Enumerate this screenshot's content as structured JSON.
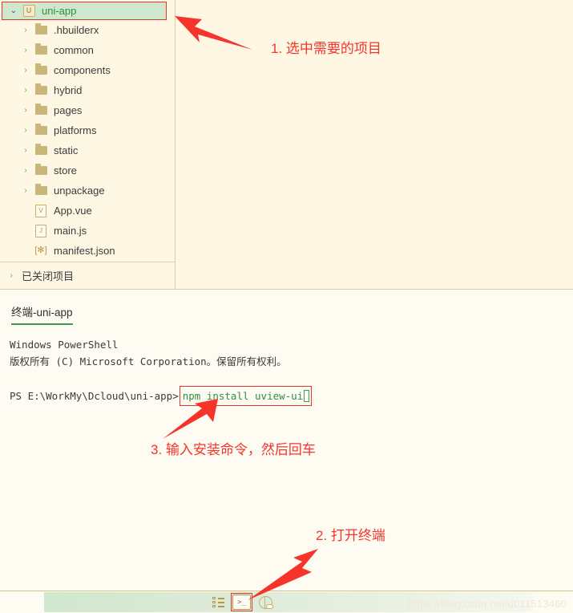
{
  "explorer": {
    "root": {
      "label": "uni-app",
      "icon": "uni-app-logo-icon",
      "chevron": "⌄",
      "badge": "U"
    },
    "items": [
      {
        "label": ".hbuilderx",
        "type": "folder",
        "chevron": "›"
      },
      {
        "label": "common",
        "type": "folder",
        "chevron": "›"
      },
      {
        "label": "components",
        "type": "folder",
        "chevron": "›"
      },
      {
        "label": "hybrid",
        "type": "folder",
        "chevron": "›"
      },
      {
        "label": "pages",
        "type": "folder",
        "chevron": "›"
      },
      {
        "label": "platforms",
        "type": "folder",
        "chevron": "›"
      },
      {
        "label": "static",
        "type": "folder",
        "chevron": "›"
      },
      {
        "label": "store",
        "type": "folder",
        "chevron": "›"
      },
      {
        "label": "unpackage",
        "type": "folder",
        "chevron": "›"
      },
      {
        "label": "App.vue",
        "type": "file",
        "glyph": "V"
      },
      {
        "label": "main.js",
        "type": "file",
        "glyph": "J"
      },
      {
        "label": "manifest.json",
        "type": "file",
        "glyph": "[✻]"
      }
    ],
    "closed_projects": {
      "label": "已关闭项目",
      "chevron": "›"
    }
  },
  "terminal": {
    "tab_label": "终端-uni-app",
    "lines": [
      "Windows PowerShell",
      "版权所有 (C) Microsoft Corporation。保留所有权利。"
    ],
    "prompt": "PS E:\\WorkMy\\Dcloud\\uni-app>",
    "command": "npm install uview-ui"
  },
  "statusbar": {
    "outline_icon": "outline-list-icon",
    "terminal_icon": "terminal-icon",
    "cloud_icon": "cloud-icon",
    "watermark": "https://blog.csdn.net/u011513460"
  },
  "annotations": [
    {
      "id": "anno1",
      "text": "1. 选中需要的项目"
    },
    {
      "id": "anno3",
      "text": "3. 输入安装命令，然后回车"
    },
    {
      "id": "anno2",
      "text": "2. 打开终端"
    }
  ],
  "colors": {
    "accent_red": "#f5352b",
    "accent_green": "#2f8f3e",
    "panel_bg": "#fdf7e3",
    "body_bg": "#fdfbf2",
    "folder": "#cbb679"
  }
}
